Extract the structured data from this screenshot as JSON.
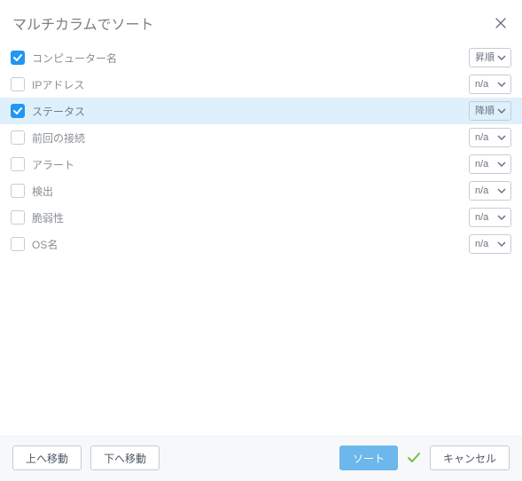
{
  "dialog": {
    "title": "マルチカラムでソート"
  },
  "columns": [
    {
      "checked": true,
      "selected": false,
      "label": "コンピューター名",
      "order": "昇順"
    },
    {
      "checked": false,
      "selected": false,
      "label": "IPアドレス",
      "order": "n/a"
    },
    {
      "checked": true,
      "selected": true,
      "label": "ステータス",
      "order": "降順"
    },
    {
      "checked": false,
      "selected": false,
      "label": "前回の接続",
      "order": "n/a"
    },
    {
      "checked": false,
      "selected": false,
      "label": "アラート",
      "order": "n/a"
    },
    {
      "checked": false,
      "selected": false,
      "label": "検出",
      "order": "n/a"
    },
    {
      "checked": false,
      "selected": false,
      "label": "脆弱性",
      "order": "n/a"
    },
    {
      "checked": false,
      "selected": false,
      "label": "OS名",
      "order": "n/a"
    }
  ],
  "orderOptions": [
    "昇順",
    "降順",
    "n/a"
  ],
  "footer": {
    "moveUp": "上へ移動",
    "moveDown": "下へ移動",
    "sort": "ソート",
    "cancel": "キャンセル"
  }
}
